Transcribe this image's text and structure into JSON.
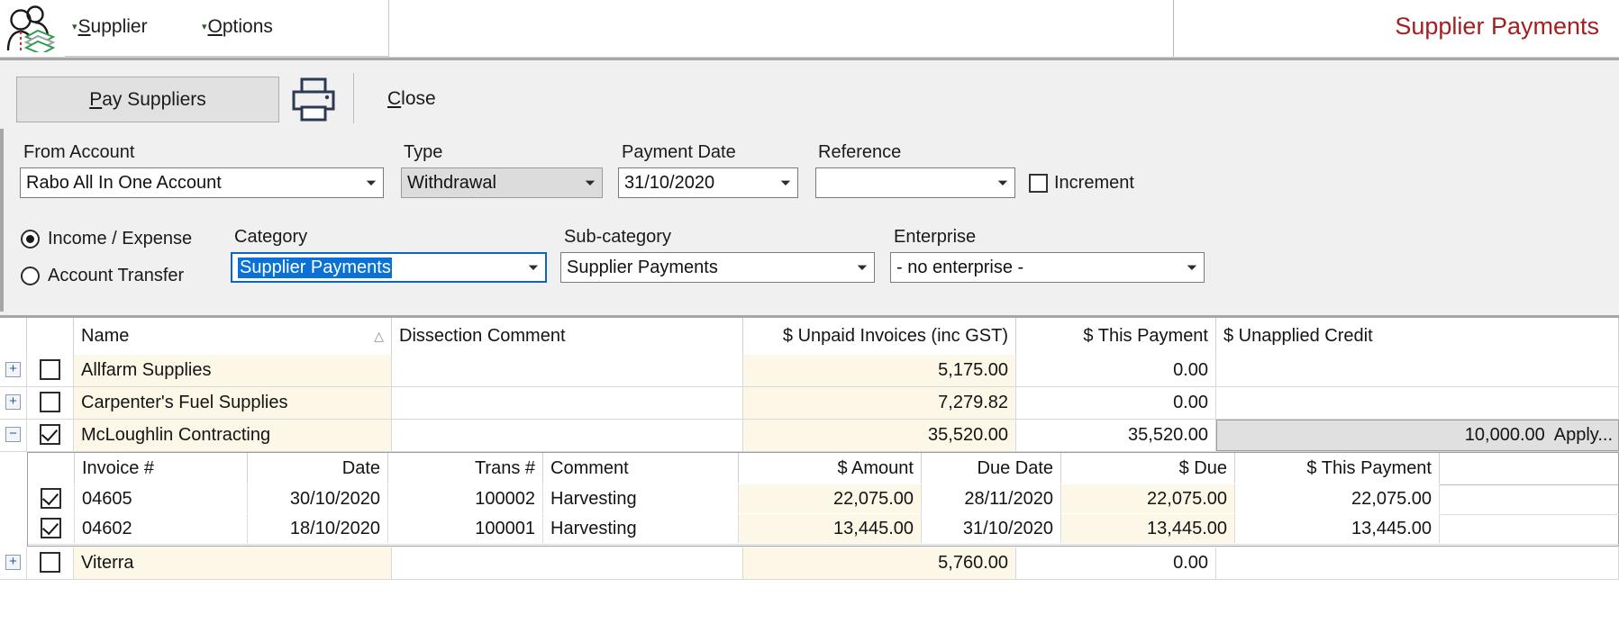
{
  "window": {
    "title": "Supplier Payments",
    "title_color": "#a32020",
    "app_icon": "supplier-payments-icon"
  },
  "menubar": {
    "items": [
      {
        "label": "Supplier",
        "accel": "S",
        "caret": "▾"
      },
      {
        "label": "Options",
        "accel": "O",
        "caret": "▾"
      }
    ]
  },
  "toolbar": {
    "pay_suppliers_label": "Pay Suppliers",
    "pay_suppliers_accel": "P",
    "print_icon": "printer-icon",
    "close_label": "Close",
    "close_accel": "C"
  },
  "form": {
    "from_account": {
      "label": "From Account",
      "value": "Rabo All In One Account"
    },
    "type": {
      "label": "Type",
      "value": "Withdrawal",
      "disabled": true
    },
    "payment_date": {
      "label": "Payment Date",
      "value": "31/10/2020"
    },
    "reference": {
      "label": "Reference",
      "value": ""
    },
    "increment": {
      "label": "Increment",
      "checked": false
    },
    "mode": {
      "income_expense_label": "Income / Expense",
      "account_transfer_label": "Account Transfer",
      "selected": "income_expense"
    },
    "category": {
      "label": "Category",
      "value": "Supplier Payments",
      "focused": true
    },
    "sub_category": {
      "label": "Sub-category",
      "value": "Supplier Payments"
    },
    "enterprise": {
      "label": "Enterprise",
      "value": "- no enterprise -"
    }
  },
  "grid": {
    "headers": {
      "name": "Name",
      "dissection_comment": "Dissection Comment",
      "unpaid_invoices": "$ Unpaid Invoices (inc GST)",
      "this_payment": "$ This Payment",
      "unapplied_credit": "$ Unapplied Credit"
    },
    "sort_indicator": "△",
    "rows": [
      {
        "expander": "+",
        "checked": false,
        "name": "Allfarm Supplies",
        "dissection_comment": "",
        "unpaid_invoices": "5,175.00",
        "this_payment": "0.00",
        "unapplied_credit": ""
      },
      {
        "expander": "+",
        "checked": false,
        "name": "Carpenter's Fuel Supplies",
        "dissection_comment": "",
        "unpaid_invoices": "7,279.82",
        "this_payment": "0.00",
        "unapplied_credit": ""
      },
      {
        "expander": "−",
        "checked": true,
        "name": "McLoughlin Contracting",
        "dissection_comment": "",
        "unpaid_invoices": "35,520.00",
        "this_payment": "35,520.00",
        "unapplied_credit": "10,000.00",
        "apply_label": "Apply..."
      },
      {
        "expander": "+",
        "checked": false,
        "name": "Viterra",
        "dissection_comment": "",
        "unpaid_invoices": "5,760.00",
        "this_payment": "0.00",
        "unapplied_credit": ""
      }
    ],
    "subgrid": {
      "headers": {
        "invoice_no": "Invoice #",
        "date": "Date",
        "trans_no": "Trans #",
        "comment": "Comment",
        "amount": "$ Amount",
        "due_date": "Due Date",
        "due": "$ Due",
        "this_payment": "$ This Payment"
      },
      "rows": [
        {
          "checked": true,
          "invoice_no": "04605",
          "date": "30/10/2020",
          "trans_no": "100002",
          "comment": "Harvesting",
          "amount": "22,075.00",
          "due_date": "28/11/2020",
          "due": "22,075.00",
          "this_payment": "22,075.00"
        },
        {
          "checked": true,
          "invoice_no": "04602",
          "date": "18/10/2020",
          "trans_no": "100001",
          "comment": "Harvesting",
          "amount": "13,445.00",
          "due_date": "31/10/2020",
          "due": "13,445.00",
          "this_payment": "13,445.00"
        }
      ]
    }
  }
}
